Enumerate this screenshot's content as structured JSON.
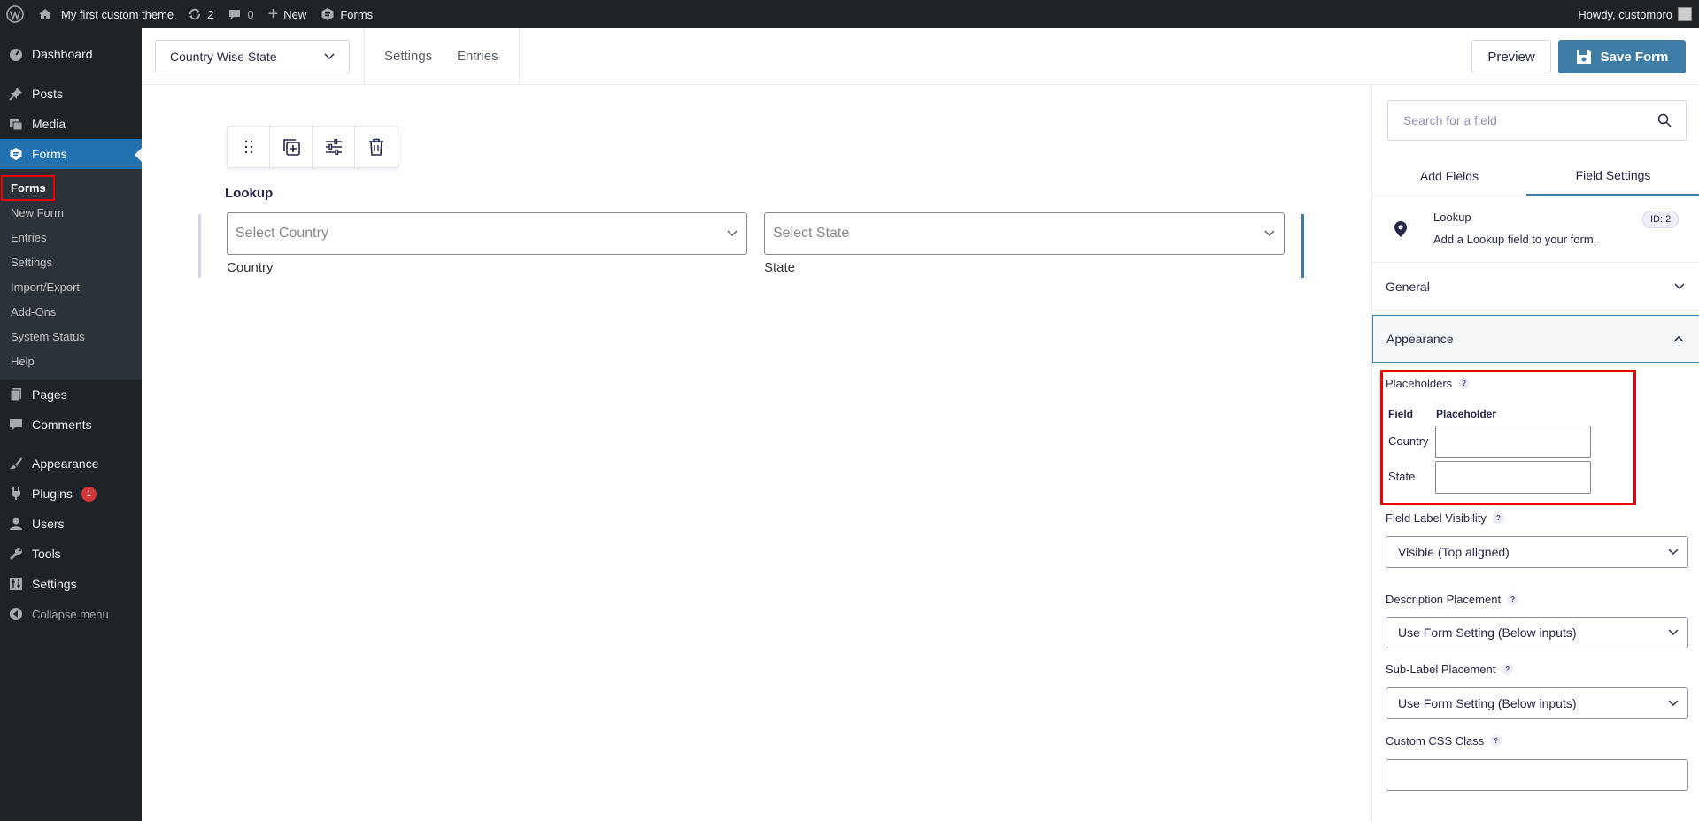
{
  "adminbar": {
    "site_name": "My first custom theme",
    "updates_count": "2",
    "comments_count": "0",
    "new_label": "New",
    "forms_label": "Forms",
    "greeting": "Howdy, custompro"
  },
  "sidebar": {
    "dashboard": "Dashboard",
    "posts": "Posts",
    "media": "Media",
    "forms": "Forms",
    "submenu": [
      "Forms",
      "New Form",
      "Entries",
      "Settings",
      "Import/Export",
      "Add-Ons",
      "System Status",
      "Help"
    ],
    "pages": "Pages",
    "comments": "Comments",
    "appearance": "Appearance",
    "plugins": "Plugins",
    "plugins_badge": "1",
    "users": "Users",
    "tools": "Tools",
    "settings": "Settings",
    "collapse": "Collapse menu"
  },
  "toolbar": {
    "form_name": "Country Wise State",
    "settings_link": "Settings",
    "entries_link": "Entries",
    "preview_label": "Preview",
    "save_label": "Save Form"
  },
  "canvas": {
    "field_title": "Lookup",
    "select_country_placeholder": "Select Country",
    "select_state_placeholder": "Select State",
    "country_sublabel": "Country",
    "state_sublabel": "State"
  },
  "panel": {
    "search_placeholder": "Search for a field",
    "tab_add_fields": "Add Fields",
    "tab_field_settings": "Field Settings",
    "field_name": "Lookup",
    "field_desc": "Add a Lookup field to your form.",
    "field_id": "ID: 2",
    "general_label": "General",
    "appearance_label": "Appearance",
    "placeholders_label": "Placeholders",
    "ph_col_field": "Field",
    "ph_col_placeholder": "Placeholder",
    "ph_row_country": "Country",
    "ph_row_state": "State",
    "label_visibility_label": "Field Label Visibility",
    "label_visibility_value": "Visible (Top aligned)",
    "desc_placement_label": "Description Placement",
    "desc_placement_value": "Use Form Setting (Below inputs)",
    "sublabel_placement_label": "Sub-Label Placement",
    "sublabel_placement_value": "Use Form Setting (Below inputs)",
    "css_class_label": "Custom CSS Class",
    "help_glyph": "?"
  },
  "colors": {
    "admin_dark": "#1d2327",
    "accent_blue": "#2271b1",
    "gf_blue": "#3e7da6",
    "highlight_red": "#e00000"
  }
}
